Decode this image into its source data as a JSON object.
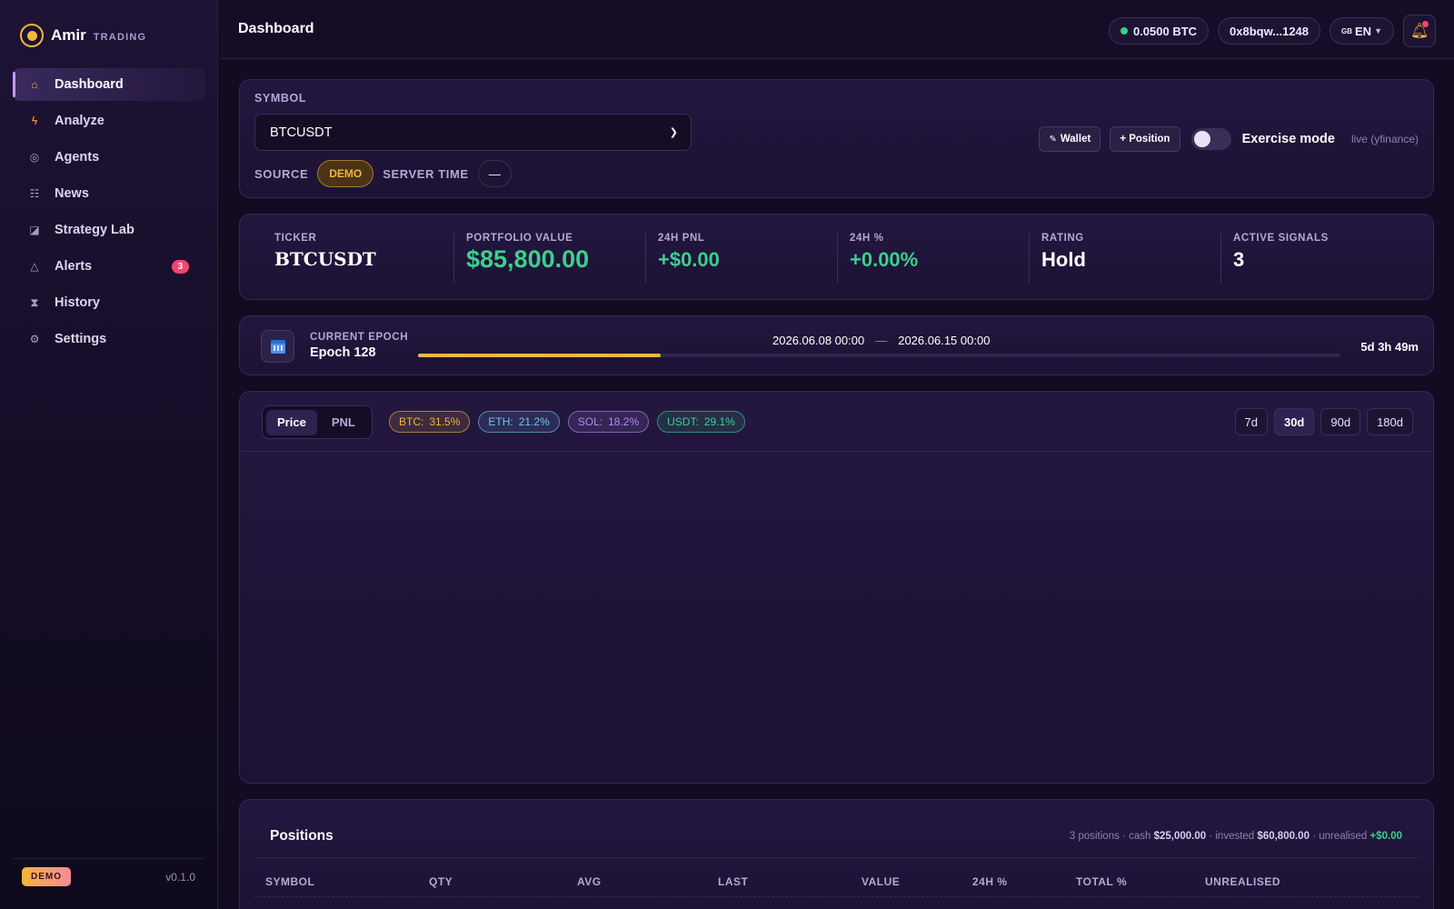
{
  "brand": {
    "name": "Amir",
    "sub": "TRADING"
  },
  "nav": [
    {
      "label": "Dashboard",
      "icon": "home-icon",
      "glyph": "⌂"
    },
    {
      "label": "Analyze",
      "icon": "bolt-icon",
      "glyph": "ϟ"
    },
    {
      "label": "Agents",
      "icon": "agent-icon",
      "glyph": "◎"
    },
    {
      "label": "News",
      "icon": "news-icon",
      "glyph": "☷"
    },
    {
      "label": "Strategy Lab",
      "icon": "lab-icon",
      "glyph": "◪"
    },
    {
      "label": "Alerts",
      "icon": "alert-icon",
      "glyph": "△",
      "badge": "3"
    },
    {
      "label": "History",
      "icon": "history-icon",
      "glyph": "⧗"
    },
    {
      "label": "Settings",
      "icon": "settings-icon",
      "glyph": "⚙"
    }
  ],
  "sidebar_footer": {
    "mode": "DEMO",
    "version": "v0.1.0"
  },
  "header": {
    "title": "Dashboard",
    "balance": "0.0500 BTC",
    "wallet": "0x8bqw...1248",
    "flag": "GB",
    "language": "EN"
  },
  "symbol_panel": {
    "symbol_label": "SYMBOL",
    "symbol_value": "BTCUSDT",
    "source_label": "SOURCE",
    "source_value": "DEMO",
    "server_time_label": "SERVER TIME",
    "server_time_value": "—",
    "wallet_button": "Wallet",
    "position_button": "+ Position",
    "exercise_label": "Exercise mode",
    "exercise_on": false,
    "live_label": "live (yfinance)"
  },
  "stats": [
    {
      "label": "TICKER",
      "value": "BTCUSDT"
    },
    {
      "label": "PORTFOLIO VALUE",
      "value": "$85,800.00"
    },
    {
      "label": "24H PNL",
      "value": "+$0.00"
    },
    {
      "label": "24H %",
      "value": "+0.00%"
    },
    {
      "label": "RATING",
      "value": "Hold"
    },
    {
      "label": "ACTIVE SIGNALS",
      "value": "3"
    }
  ],
  "epoch": {
    "label": "CURRENT EPOCH",
    "name": "Epoch 128",
    "start": "2026.06.08 00:00",
    "end": "2026.06.15 00:00",
    "separator": "—",
    "remaining": "5d 3h 49m",
    "progress": 0.263
  },
  "chart": {
    "tabs": [
      "Price",
      "PNL"
    ],
    "active_tab": "Price",
    "allocations": [
      {
        "asset": "BTC:",
        "pct": "31.5%",
        "color": "#f2b63a"
      },
      {
        "asset": "ETH:",
        "pct": "21.2%",
        "color": "#6ec3f2"
      },
      {
        "asset": "SOL:",
        "pct": "18.2%",
        "color": "#b58cf0"
      },
      {
        "asset": "USDT:",
        "pct": "29.1%",
        "color": "#3ccf8e"
      }
    ],
    "ranges": [
      "7d",
      "30d",
      "90d",
      "180d"
    ],
    "active_range": "30d"
  },
  "positions": {
    "title": "Positions",
    "summary": {
      "count": "3 positions",
      "cash_label": "cash",
      "cash": "$25,000.00",
      "invested_label": "invested",
      "invested": "$60,800.00",
      "unrealised_label": "unrealised",
      "unrealised": "+$0.00"
    },
    "columns": [
      "SYMBOL",
      "QTY",
      "AVG",
      "LAST",
      "VALUE",
      "24H %",
      "TOTAL %",
      "UNREALISED"
    ]
  },
  "colors": {
    "accent": "#f2b63a",
    "positive": "#3ccf8e",
    "badge": "#f04770",
    "bg": "#120b22"
  }
}
